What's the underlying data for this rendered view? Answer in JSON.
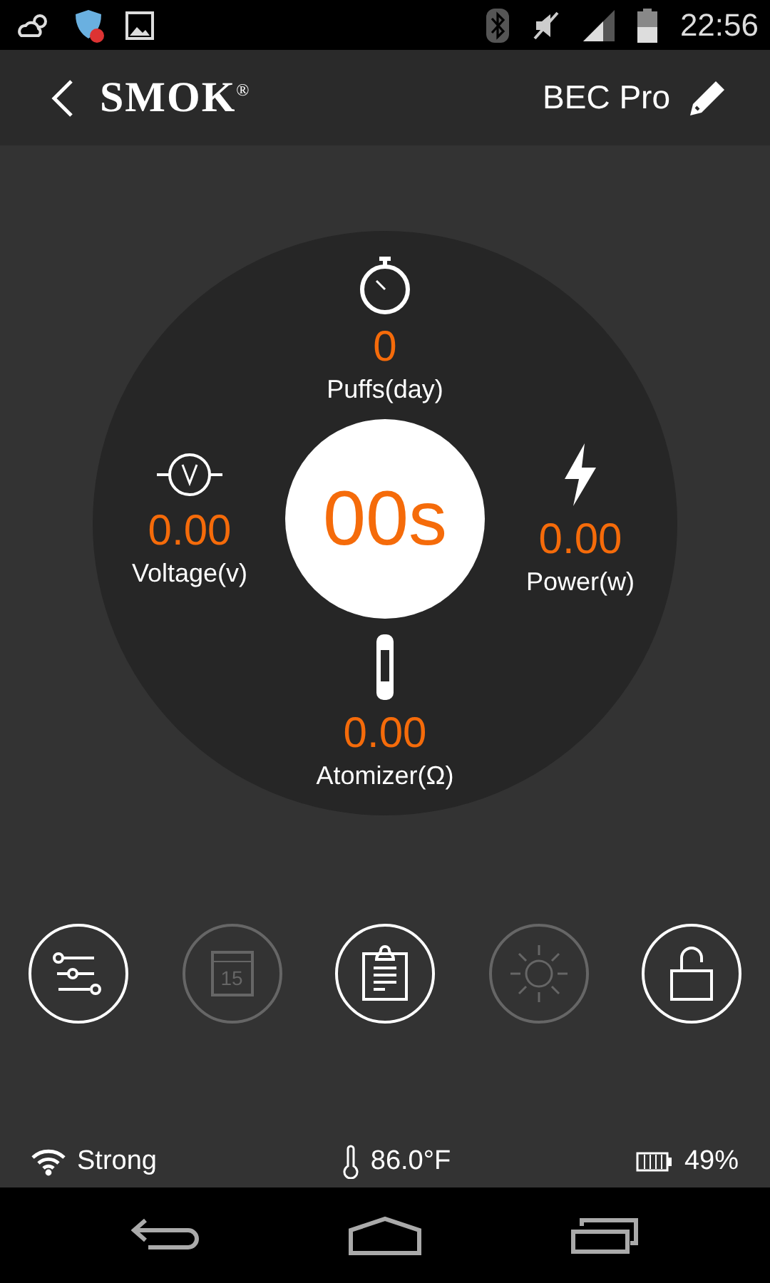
{
  "status_bar": {
    "time": "22:56"
  },
  "header": {
    "logo": "SMOK$^{®}$",
    "device": "BEC Pro"
  },
  "dial": {
    "timer": "00s",
    "metrics": [
      {
        "kind": "puffs",
        "value": "0",
        "label": "Puffs(day)"
      },
      {
        "kind": "voltage",
        "value": "0.00",
        "label": "Voltage(v)"
      },
      {
        "kind": "power",
        "value": "0.00",
        "label": "Power(w)"
      },
      {
        "kind": "atomizer",
        "value": "0.00",
        "label": "Atomizer(Ω)"
      }
    ]
  },
  "actions": [
    {
      "kind": "settings",
      "disabled": false
    },
    {
      "kind": "calendar",
      "disabled": true,
      "text": "15"
    },
    {
      "kind": "clipboard",
      "disabled": false
    },
    {
      "kind": "brightness",
      "disabled": true
    },
    {
      "kind": "lock",
      "disabled": false
    }
  ],
  "footer": {
    "signal": "Strong",
    "temperature": "86.0°F",
    "battery": "49%"
  }
}
